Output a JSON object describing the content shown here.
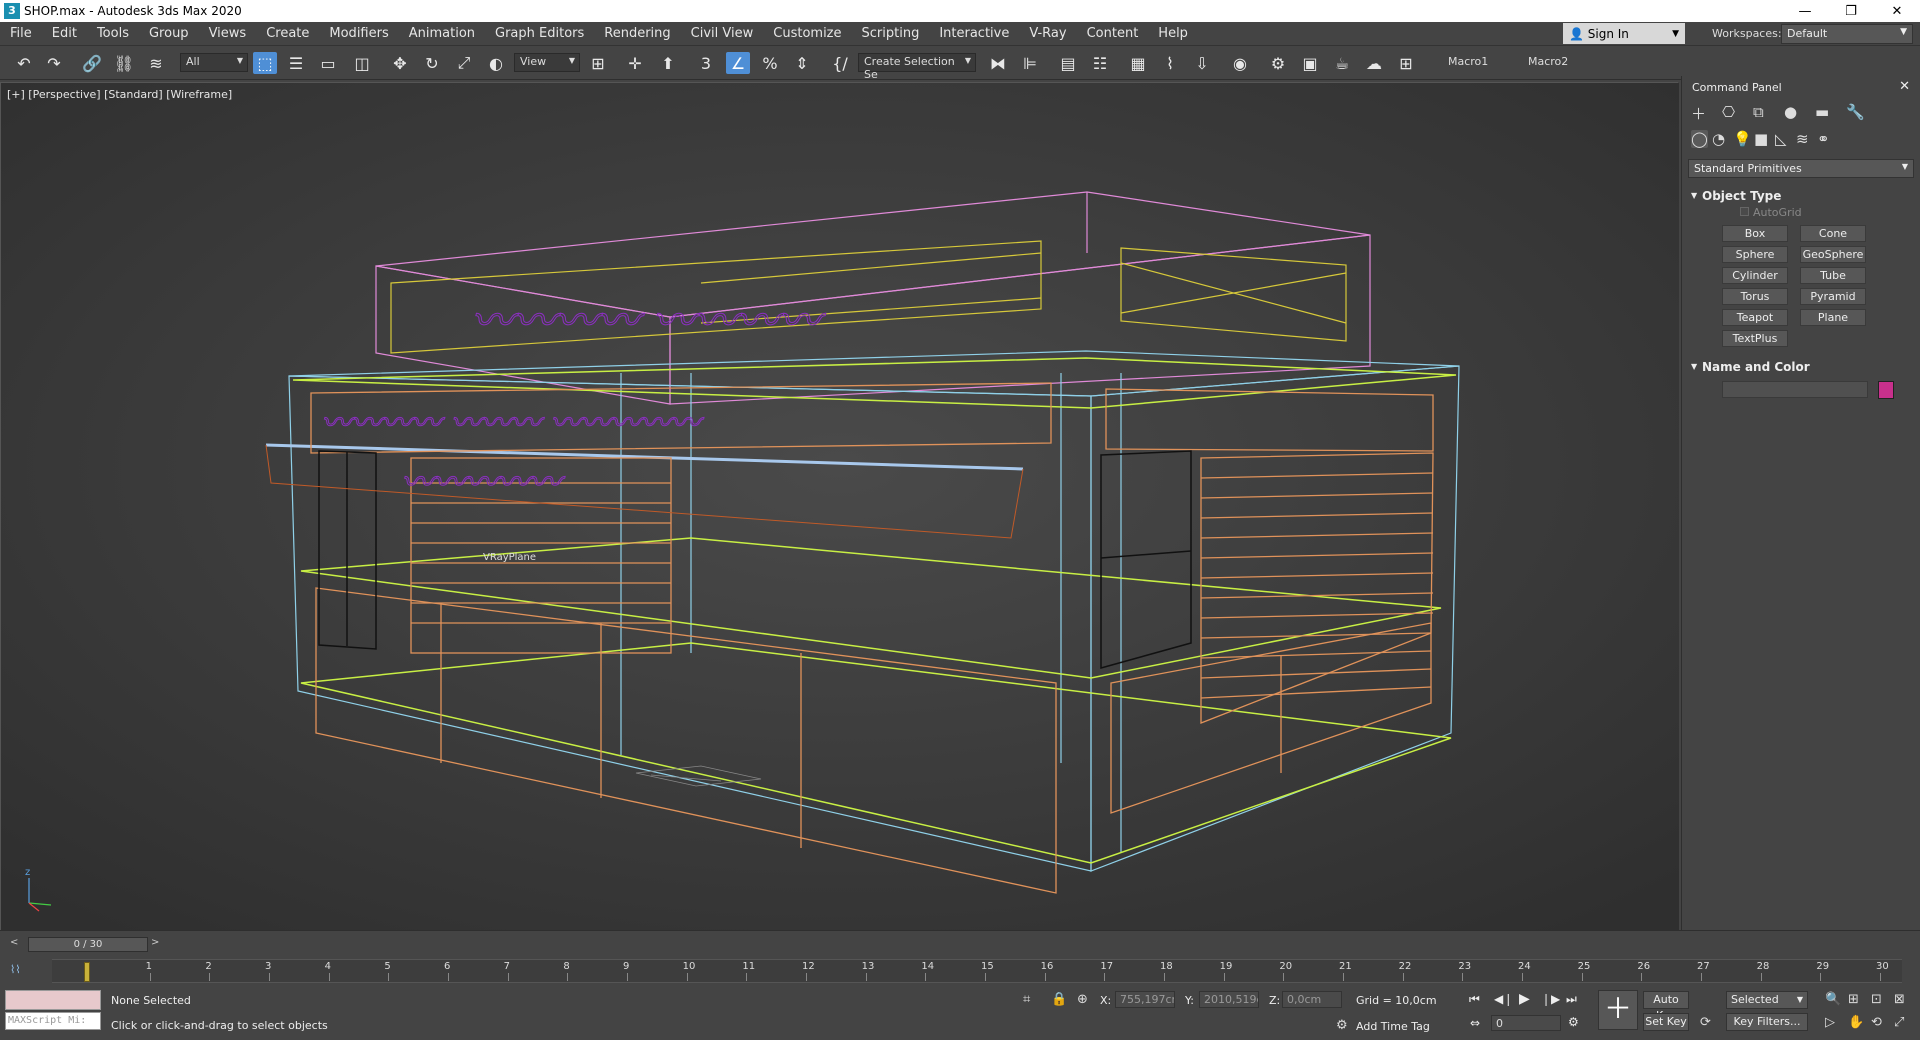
{
  "window": {
    "title": "SHOP.max - Autodesk 3ds Max 2020",
    "app_icon": "3",
    "controls": [
      "—",
      "❐",
      "✕"
    ]
  },
  "menu": [
    "File",
    "Edit",
    "Tools",
    "Group",
    "Views",
    "Create",
    "Modifiers",
    "Animation",
    "Graph Editors",
    "Rendering",
    "Civil View",
    "Customize",
    "Scripting",
    "Interactive",
    "V-Ray",
    "Content",
    "Help"
  ],
  "account": {
    "sign_in": "Sign In",
    "workspaces_label": "Workspaces:",
    "workspace": "Default"
  },
  "toolbar": {
    "filter": "All",
    "refcoord": "View",
    "selection_set": "Create Selection Se",
    "macro1": "Macro1",
    "macro2": "Macro2",
    "snap_label": "3"
  },
  "viewport": {
    "label": "[+] [Perspective] [Standard] [Wireframe]",
    "object_label": "VRayPlane"
  },
  "command_panel": {
    "title": "Command Panel",
    "category": "Standard Primitives",
    "object_type": "Object Type",
    "autogrid": "AutoGrid",
    "primitives": [
      "Box",
      "Cone",
      "Sphere",
      "GeoSphere",
      "Cylinder",
      "Tube",
      "Torus",
      "Pyramid",
      "Teapot",
      "Plane",
      "TextPlus"
    ],
    "name_and_color": "Name and Color",
    "swatch_color": "#c8308c"
  },
  "timeline": {
    "frame_display": "0 / 30",
    "ticks": [
      "1",
      "2",
      "3",
      "4",
      "5",
      "6",
      "7",
      "8",
      "9",
      "10",
      "11",
      "12",
      "13",
      "14",
      "15",
      "16",
      "17",
      "18",
      "19",
      "20",
      "21",
      "22",
      "23",
      "24",
      "25",
      "26",
      "27",
      "28",
      "29",
      "30"
    ]
  },
  "status": {
    "maxscript": "MAXScript Mi:",
    "selection": "None Selected",
    "hint": "Click or click-and-drag to select objects",
    "x_label": "X:",
    "x_value": "755,197cm",
    "y_label": "Y:",
    "y_value": "2010,519c",
    "z_label": "Z:",
    "z_value": "0,0cm",
    "grid": "Grid = 10,0cm",
    "add_time_tag": "Add Time Tag",
    "auto_key": "Auto Key",
    "set_key": "Set Key",
    "key_mode": "Selected",
    "key_filters": "Key Filters...",
    "current_frame": "0"
  }
}
